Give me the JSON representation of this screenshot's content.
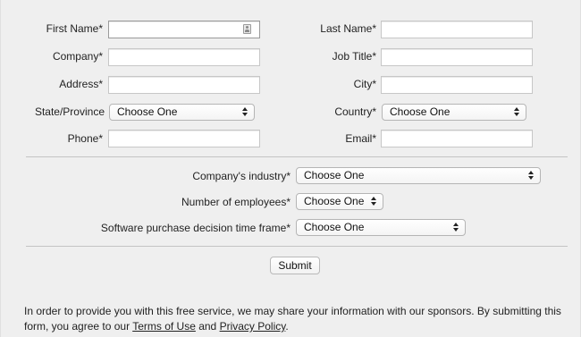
{
  "form": {
    "first_name": {
      "label": "First Name*",
      "value": ""
    },
    "last_name": {
      "label": "Last Name*",
      "value": ""
    },
    "company": {
      "label": "Company*",
      "value": ""
    },
    "job_title": {
      "label": "Job Title*",
      "value": ""
    },
    "address": {
      "label": "Address*",
      "value": ""
    },
    "city": {
      "label": "City*",
      "value": ""
    },
    "state": {
      "label": "State/Province",
      "selected": "Choose One"
    },
    "country": {
      "label": "Country*",
      "selected": "Choose One"
    },
    "phone": {
      "label": "Phone*",
      "value": ""
    },
    "email": {
      "label": "Email*",
      "value": ""
    },
    "industry": {
      "label": "Company's industry*",
      "selected": "Choose One"
    },
    "employees": {
      "label": "Number of employees*",
      "selected": "Choose One"
    },
    "timeframe": {
      "label": "Software purchase decision time frame*",
      "selected": "Choose One"
    },
    "submit_label": "Submit"
  },
  "disclaimer": {
    "text_before": "In order to provide you with this free service, we may share your information with our sponsors. By submitting this form, you agree to our ",
    "terms_link": "Terms of Use",
    "and_text": " and ",
    "privacy_link": "Privacy Policy",
    "period": "."
  },
  "icons": {
    "autofill": "contact-card-icon",
    "select_arrows": "up-down-chevron-icon"
  },
  "colors": {
    "background": "#efefef",
    "input_border": "#c7c7c7",
    "divider": "#c4c4c4",
    "text": "#222222"
  }
}
